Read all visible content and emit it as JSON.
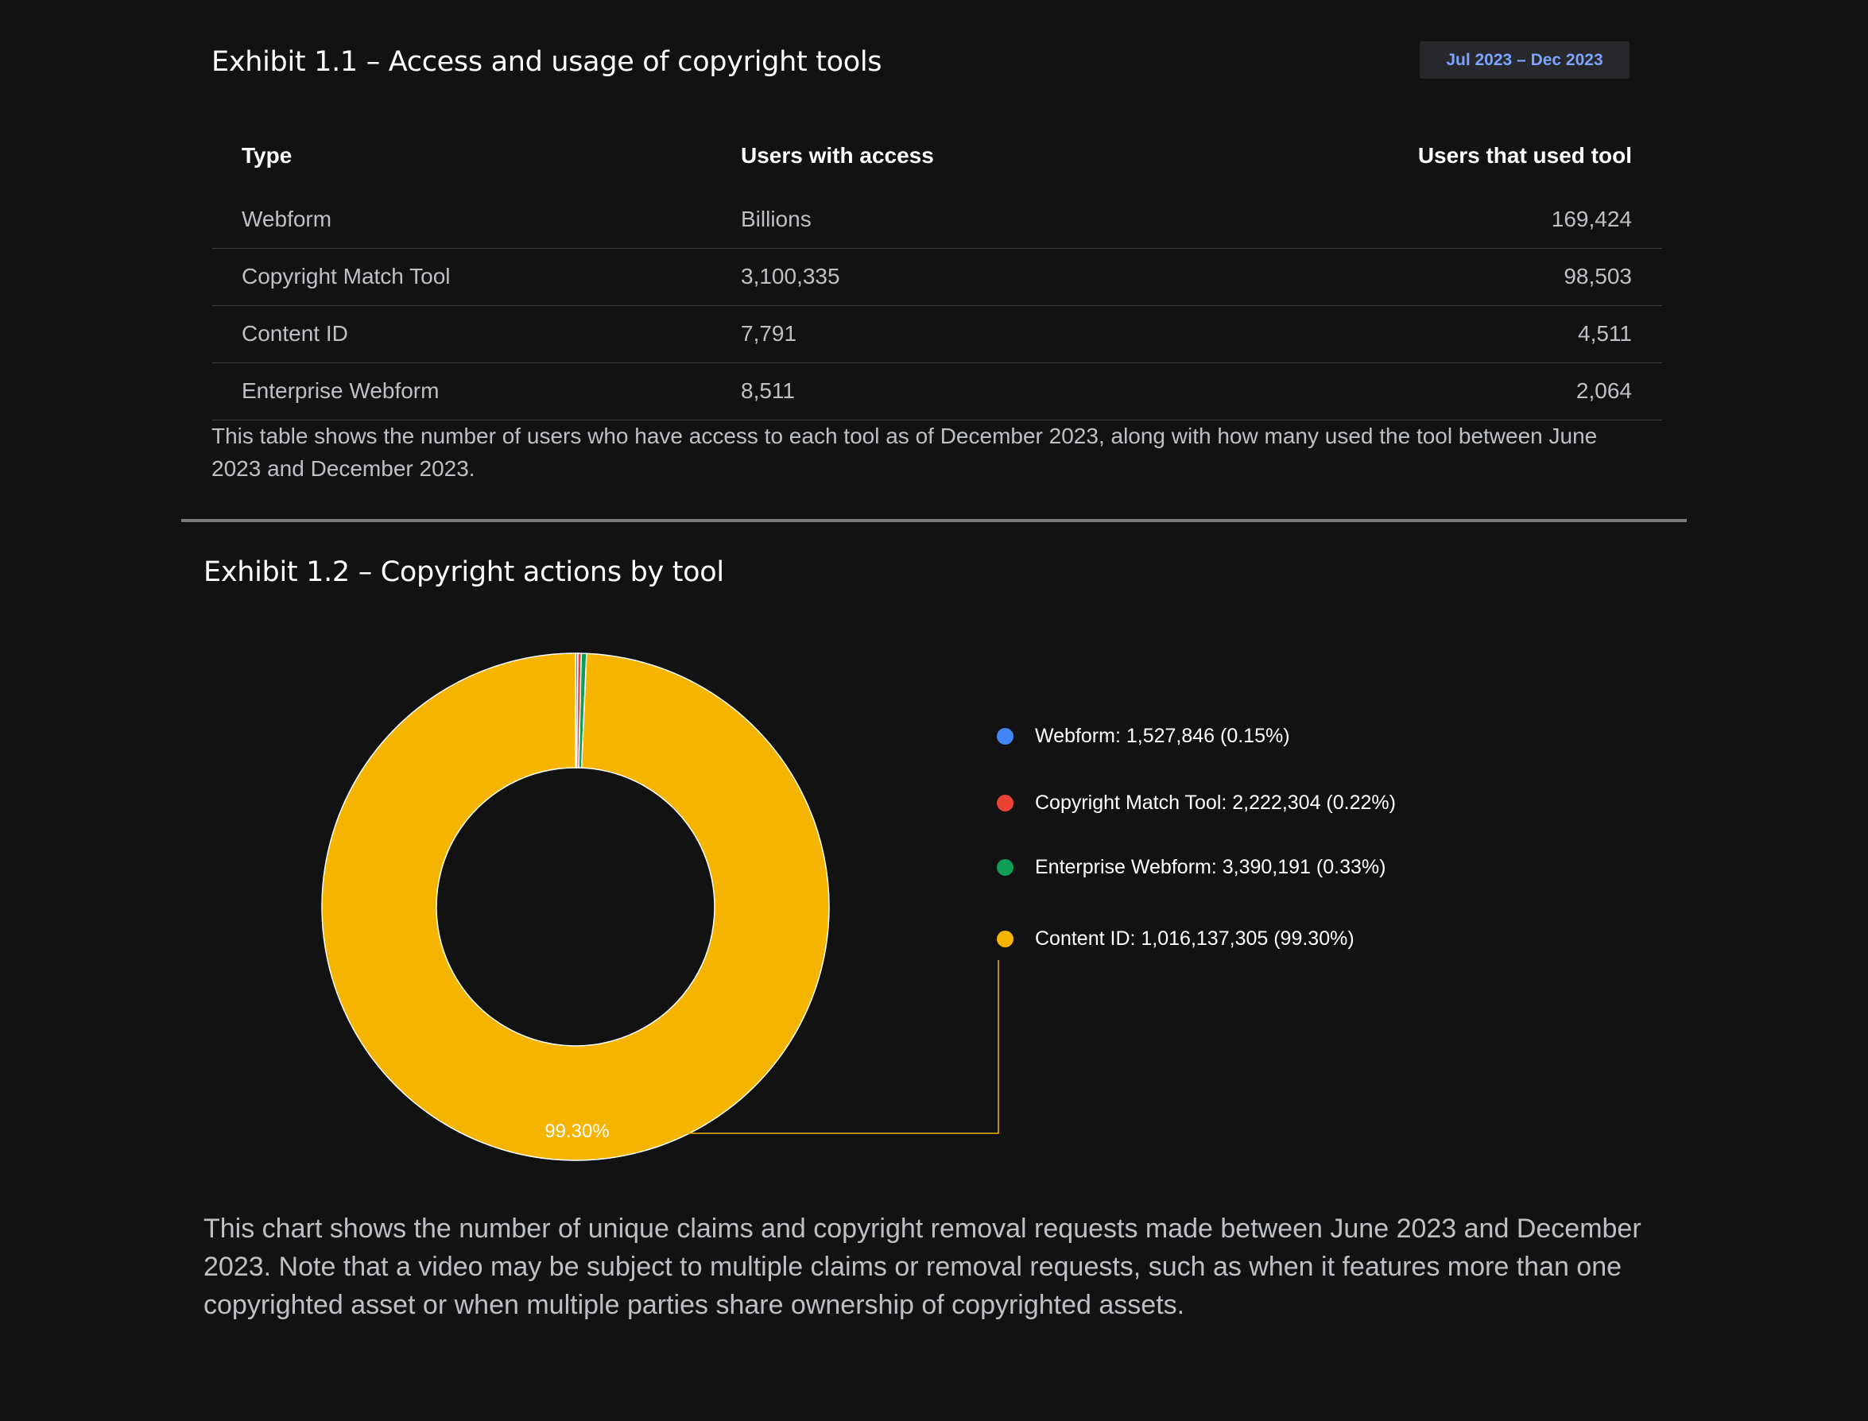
{
  "exhibit1": {
    "title": "Exhibit 1.1 – Access and usage of copyright tools",
    "date_range": "Jul 2023 – Dec 2023",
    "columns": [
      "Type",
      "Users with access",
      "Users that used tool"
    ],
    "rows": [
      {
        "type": "Webform",
        "access": "Billions",
        "used": "169,424"
      },
      {
        "type": "Copyright Match Tool",
        "access": "3,100,335",
        "used": "98,503"
      },
      {
        "type": "Content ID",
        "access": "7,791",
        "used": "4,511"
      },
      {
        "type": "Enterprise Webform",
        "access": "8,511",
        "used": "2,064"
      }
    ],
    "caption": "This table shows the number of users who have access to each tool as of December 2023, along with how many used the tool between June 2023 and December 2023."
  },
  "exhibit2": {
    "title": "Exhibit 1.2 – Copyright actions by tool",
    "legend": [
      {
        "label": "Webform: 1,527,846 (0.15%)",
        "color": "#4285f4"
      },
      {
        "label": "Copyright Match Tool: 2,222,304 (0.22%)",
        "color": "#ea4335"
      },
      {
        "label": "Enterprise Webform: 3,390,191 (0.33%)",
        "color": "#0f9d58"
      },
      {
        "label": "Content ID: 1,016,137,305 (99.30%)",
        "color": "#f4b400"
      }
    ],
    "slice_label": "99.30%",
    "caption": "This chart shows the number of unique claims and copyright removal requests made between June 2023 and December 2023. Note that a video may be subject to multiple claims or removal requests, such as when it features more than one copyrighted asset or when multiple parties share ownership of copyrighted assets."
  },
  "chart_data": {
    "type": "pie",
    "donut": true,
    "categories": [
      "Webform",
      "Copyright Match Tool",
      "Enterprise Webform",
      "Content ID"
    ],
    "values": [
      1527846,
      2222304,
      3390191,
      1016137305
    ],
    "percentages": [
      0.15,
      0.22,
      0.33,
      99.3
    ],
    "colors": [
      "#4285f4",
      "#ea4335",
      "#0f9d58",
      "#f4b400"
    ],
    "title": "Exhibit 1.2 – Copyright actions by tool",
    "legend_position": "right"
  }
}
